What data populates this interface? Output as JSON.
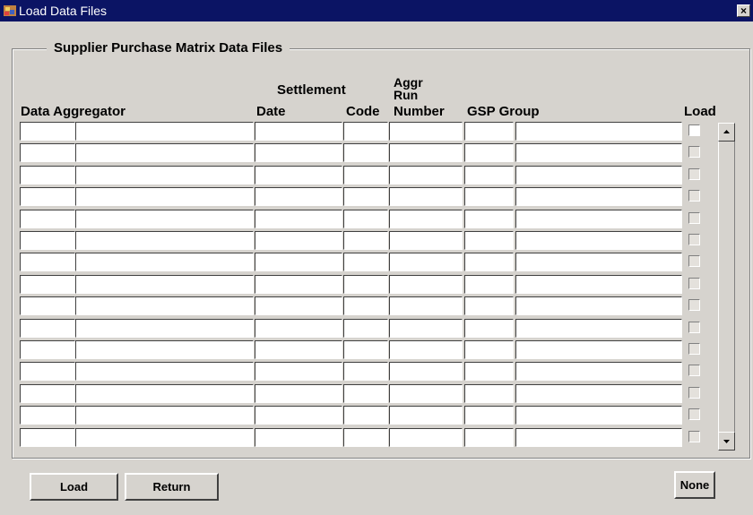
{
  "window": {
    "title": "Load Data Files",
    "close_glyph": "×"
  },
  "frame": {
    "legend": "Supplier Purchase Matrix Data Files"
  },
  "table": {
    "headers": {
      "data_aggregator": "Data Aggregator",
      "settlement": "Settlement",
      "date": "Date",
      "code": "Code",
      "aggr": "Aggr",
      "run": "Run",
      "number": "Number",
      "gsp_group": "GSP Group",
      "load": "Load"
    },
    "row_count": 15,
    "rows": [
      {
        "load": false,
        "enabled": true
      },
      {
        "load": false,
        "enabled": false
      },
      {
        "load": false,
        "enabled": false
      },
      {
        "load": false,
        "enabled": false
      },
      {
        "load": false,
        "enabled": false
      },
      {
        "load": false,
        "enabled": false
      },
      {
        "load": false,
        "enabled": false
      },
      {
        "load": false,
        "enabled": false
      },
      {
        "load": false,
        "enabled": false
      },
      {
        "load": false,
        "enabled": false
      },
      {
        "load": false,
        "enabled": false
      },
      {
        "load": false,
        "enabled": false
      },
      {
        "load": false,
        "enabled": false
      },
      {
        "load": false,
        "enabled": false
      },
      {
        "load": false,
        "enabled": false
      }
    ]
  },
  "buttons": {
    "load": "Load",
    "return": "Return",
    "none": "None"
  },
  "icons": {
    "app": "oracle-forms-icon",
    "scroll_up": "arrow-up-icon",
    "scroll_down": "arrow-down-icon"
  },
  "colors": {
    "titlebar": "#0b1464",
    "background": "#d6d3ce"
  }
}
